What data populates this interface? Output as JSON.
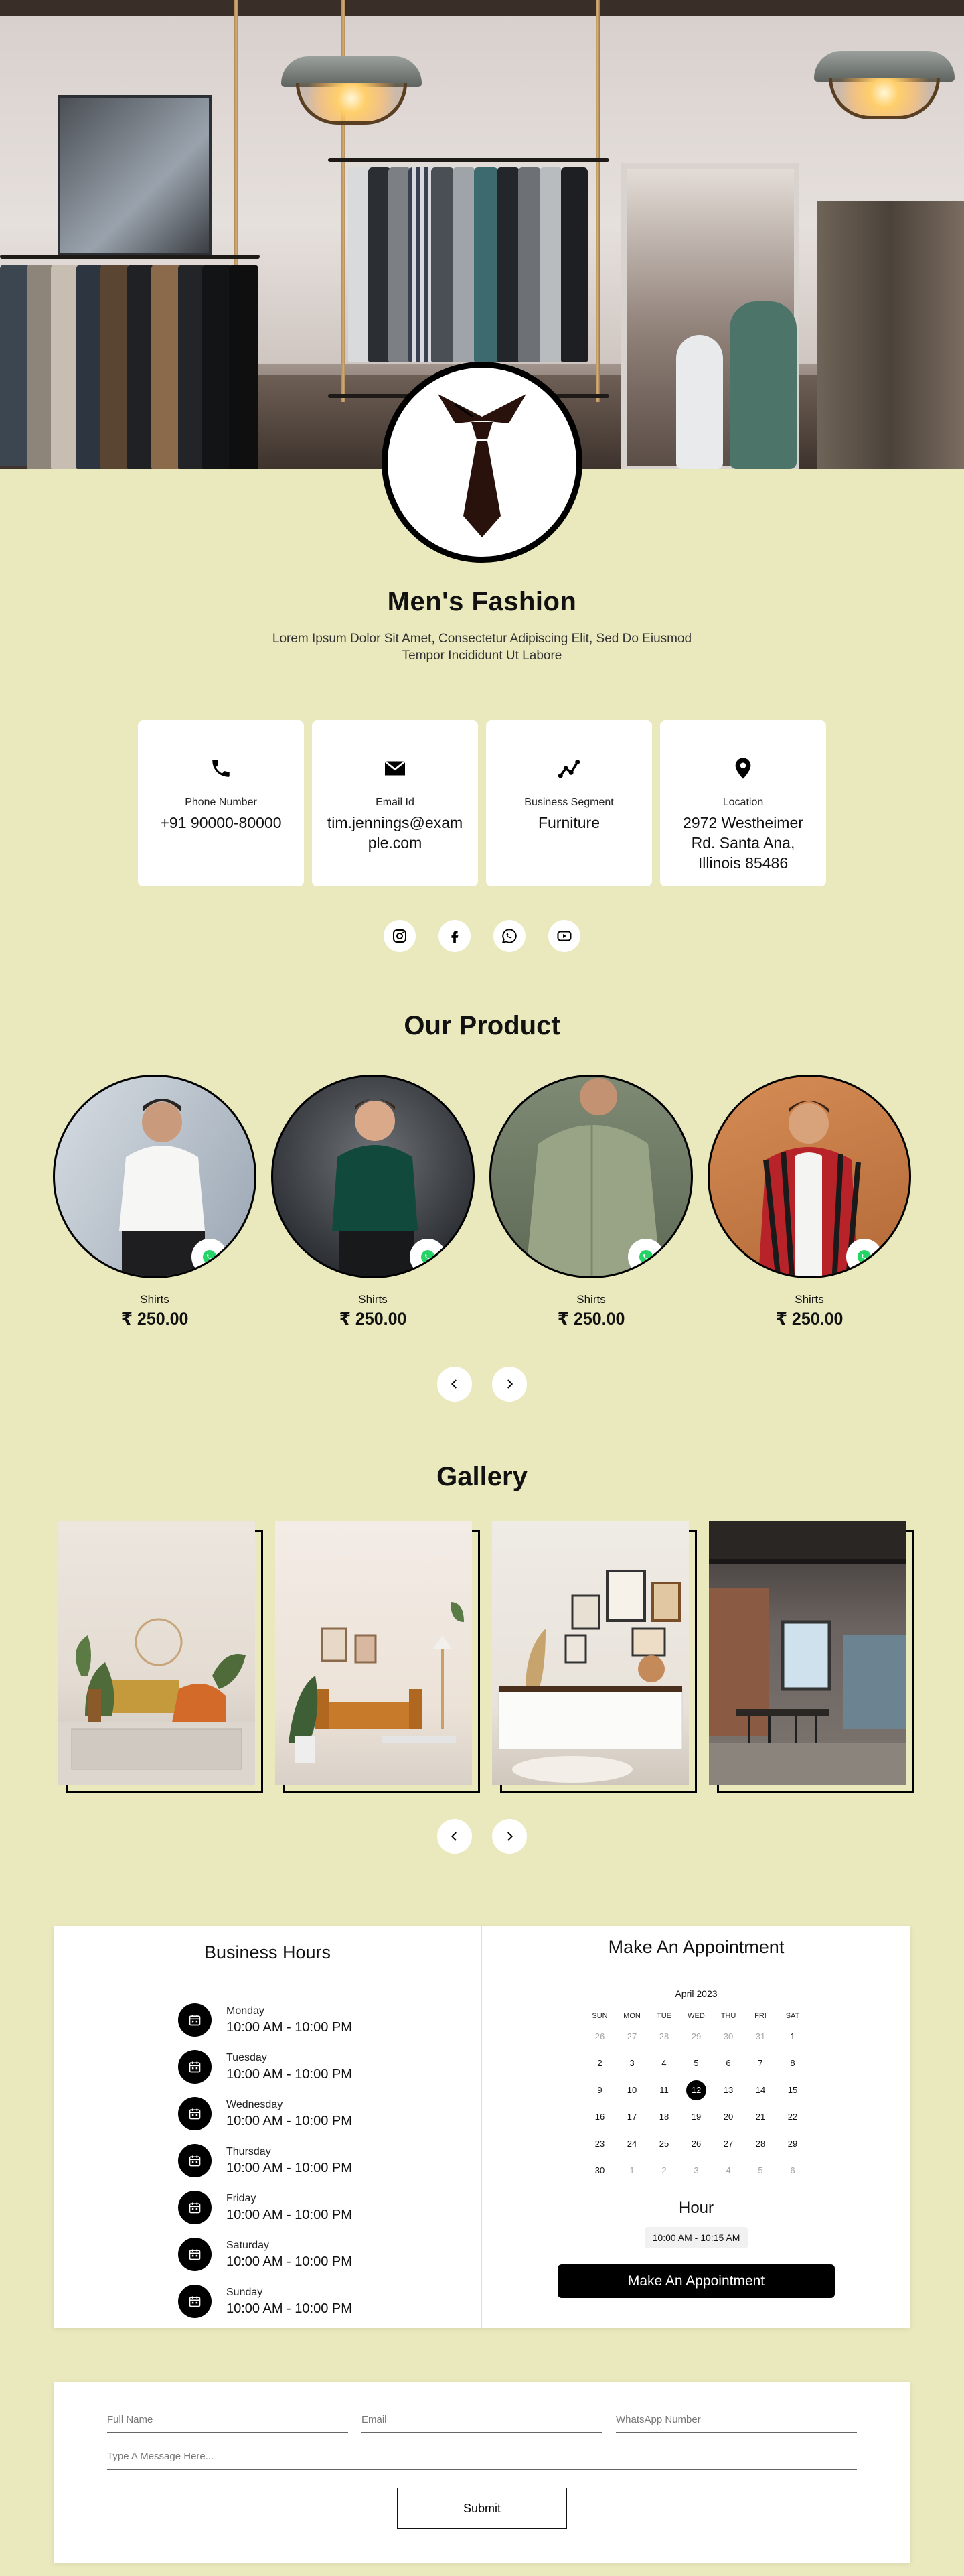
{
  "brand": {
    "name": "Men's Fashion",
    "tagline": "Lorem Ipsum Dolor Sit Amet, Consectetur Adipiscing Elit, Sed Do Eiusmod Tempor Incididunt Ut Labore"
  },
  "info": [
    {
      "label": "Phone Number",
      "value": "+91 90000-80000",
      "icon": "phone-icon"
    },
    {
      "label": "Email Id",
      "value": "tim.jennings@example.com",
      "icon": "envelope-icon"
    },
    {
      "label": "Business Segment",
      "value": "Furniture",
      "icon": "chart-line-icon"
    },
    {
      "label": "Location",
      "value": "2972 Westheimer Rd. Santa Ana, Illinois 85486",
      "icon": "map-pin-icon"
    }
  ],
  "socials": [
    "instagram-icon",
    "facebook-icon",
    "whatsapp-icon",
    "youtube-icon"
  ],
  "products": {
    "title": "Our Product",
    "items": [
      {
        "category": "Shirts",
        "price": "₹ 250.00"
      },
      {
        "category": "Shirts",
        "price": "₹ 250.00"
      },
      {
        "category": "Shirts",
        "price": "₹ 250.00"
      },
      {
        "category": "Shirts",
        "price": "₹ 250.00"
      }
    ]
  },
  "gallery": {
    "title": "Gallery"
  },
  "hours": {
    "title": "Business Hours",
    "days": [
      {
        "day": "Monday",
        "time": "10:00 AM - 10:00 PM"
      },
      {
        "day": "Tuesday",
        "time": "10:00 AM - 10:00 PM"
      },
      {
        "day": "Wednesday",
        "time": "10:00 AM - 10:00 PM"
      },
      {
        "day": "Thursday",
        "time": "10:00 AM - 10:00 PM"
      },
      {
        "day": "Friday",
        "time": "10:00 AM - 10:00 PM"
      },
      {
        "day": "Saturday",
        "time": "10:00 AM - 10:00 PM"
      },
      {
        "day": "Sunday",
        "time": "10:00 AM - 10:00 PM"
      }
    ]
  },
  "appointment": {
    "title": "Make An Appointment",
    "month": "April 2023",
    "weekdays": [
      "SUN",
      "MON",
      "TUE",
      "WED",
      "THU",
      "FRI",
      "SAT"
    ],
    "days": [
      {
        "n": "26",
        "muted": true
      },
      {
        "n": "27",
        "muted": true
      },
      {
        "n": "28",
        "muted": true
      },
      {
        "n": "29",
        "muted": true
      },
      {
        "n": "30",
        "muted": true
      },
      {
        "n": "31",
        "muted": true
      },
      {
        "n": "1"
      },
      {
        "n": "2"
      },
      {
        "n": "3"
      },
      {
        "n": "4"
      },
      {
        "n": "5"
      },
      {
        "n": "6"
      },
      {
        "n": "7"
      },
      {
        "n": "8"
      },
      {
        "n": "9"
      },
      {
        "n": "10"
      },
      {
        "n": "11"
      },
      {
        "n": "12",
        "selected": true
      },
      {
        "n": "13"
      },
      {
        "n": "14"
      },
      {
        "n": "15"
      },
      {
        "n": "16"
      },
      {
        "n": "17"
      },
      {
        "n": "18"
      },
      {
        "n": "19"
      },
      {
        "n": "20"
      },
      {
        "n": "21"
      },
      {
        "n": "22"
      },
      {
        "n": "23"
      },
      {
        "n": "24"
      },
      {
        "n": "25"
      },
      {
        "n": "26"
      },
      {
        "n": "27"
      },
      {
        "n": "28"
      },
      {
        "n": "29"
      },
      {
        "n": "30"
      },
      {
        "n": "1",
        "muted": true
      },
      {
        "n": "2",
        "muted": true
      },
      {
        "n": "3",
        "muted": true
      },
      {
        "n": "4",
        "muted": true
      },
      {
        "n": "5",
        "muted": true
      },
      {
        "n": "6",
        "muted": true
      }
    ],
    "hour_title": "Hour",
    "slot": "10:00 AM - 10:15 AM",
    "button": "Make An Appointment"
  },
  "contact": {
    "full_name_placeholder": "Full Name",
    "email_placeholder": "Email",
    "whatsapp_placeholder": "WhatsApp Number",
    "message_placeholder": "Type A Message Here...",
    "submit": "Submit"
  },
  "colors": {
    "background": "#eae9bd",
    "accent": "#000000",
    "whatsapp": "#25d366",
    "tie": "#2a120c"
  }
}
